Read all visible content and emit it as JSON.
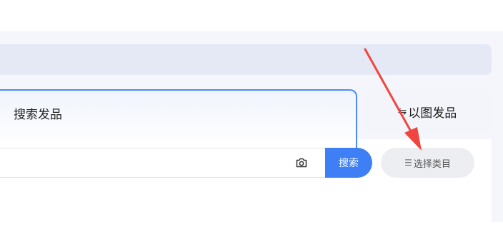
{
  "tabs": {
    "search_label": "搜索发品",
    "image_label": "以图发品",
    "image_icon": "swap-icon"
  },
  "search": {
    "value": "",
    "placeholder": "",
    "button_label": "搜索",
    "camera_icon": "camera-icon"
  },
  "category": {
    "button_label": "选择类目",
    "icon": "list-icon"
  },
  "colors": {
    "accent": "#3f7ff6",
    "tab_border": "#4c8bf5",
    "annotation_arrow": "#f0463f"
  }
}
